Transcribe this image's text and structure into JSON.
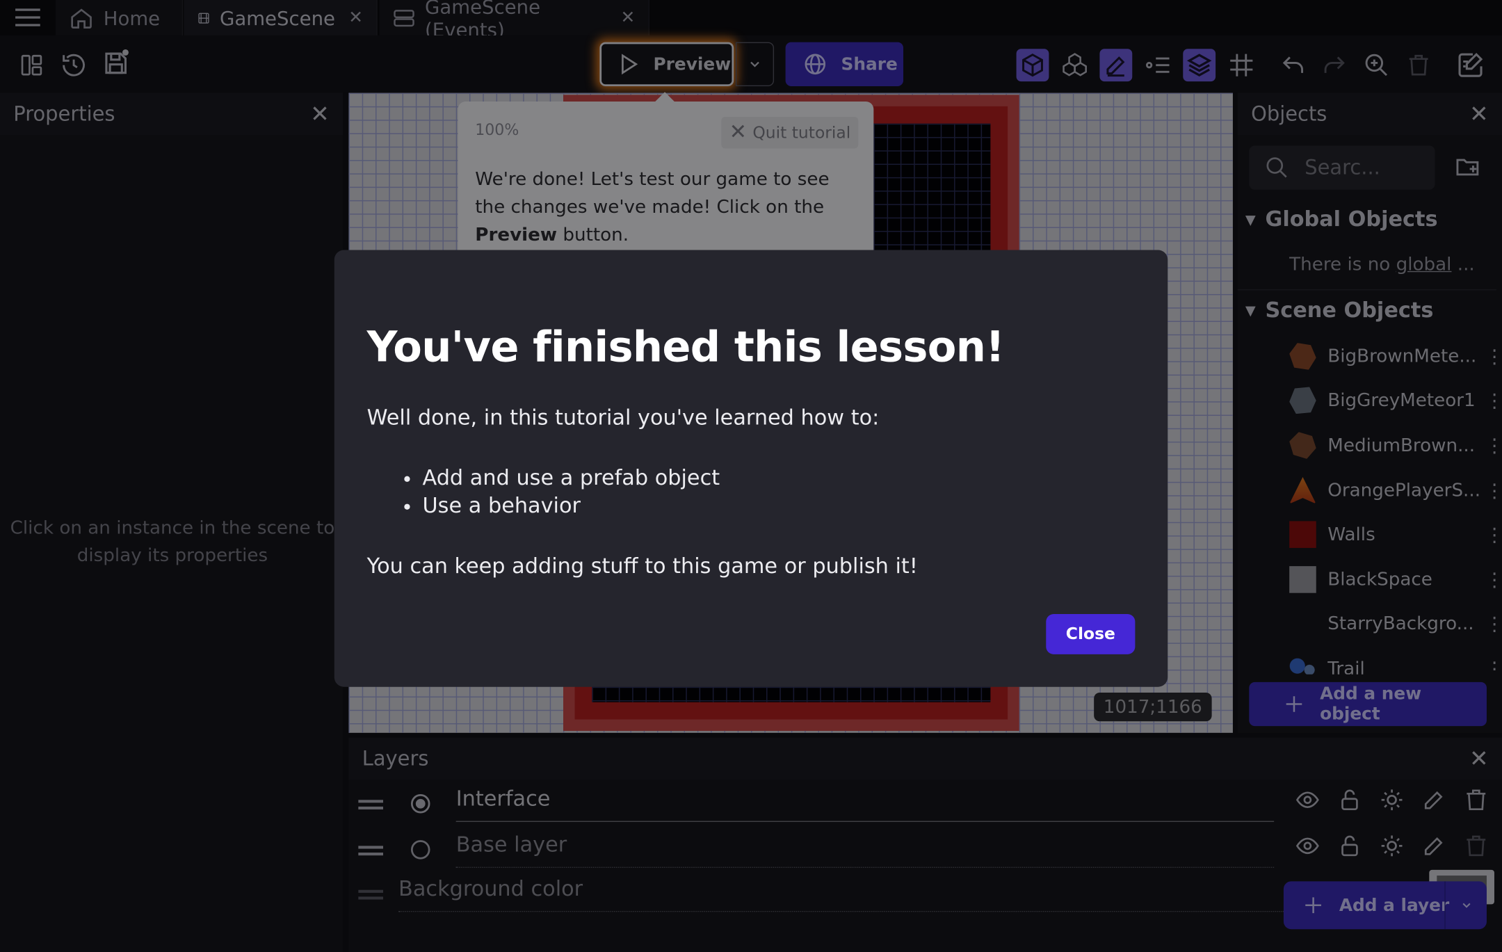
{
  "tabs": [
    {
      "label": "Home",
      "icon": "home-icon"
    },
    {
      "label": "GameScene",
      "icon": "film-icon"
    },
    {
      "label": "GameScene (Events)",
      "icon": "events-icon"
    }
  ],
  "toolbar": {
    "preview_label": "Preview",
    "share_label": "Share",
    "accent_color": "#3b2db8",
    "highlight_color": "#e07a1f"
  },
  "properties": {
    "title": "Properties",
    "empty_message": "Click on an instance in the scene to display its properties"
  },
  "canvas": {
    "coordinates": "1017;1166"
  },
  "tutorial": {
    "zoom": "100%",
    "quit_label": "Quit tutorial",
    "message_prefix": "We're done! Let's test our game to see the changes we've made! Click on the ",
    "message_bold": "Preview",
    "message_suffix": " button."
  },
  "dialog": {
    "title": "You've finished this lesson!",
    "lead": "Well done, in this tutorial you've learned how to:",
    "items": [
      "Add and use a prefab object",
      "Use a behavior"
    ],
    "footer": "You can keep adding stuff to this game or publish it!",
    "close_label": "Close"
  },
  "objects": {
    "title": "Objects",
    "search_placeholder": "Searc...",
    "global_group": "Global Objects",
    "global_empty_prefix": "There is no ",
    "global_empty_link": "global",
    "global_empty_suffix": " ...",
    "scene_group": "Scene Objects",
    "items": [
      {
        "label": "BigBrownMete...",
        "color": "#8a4a2a"
      },
      {
        "label": "BigGreyMeteor1",
        "color": "#6a7480"
      },
      {
        "label": "MediumBrown...",
        "color": "#7a4a30"
      },
      {
        "label": "OrangePlayerS...",
        "color": "#e07a1f"
      },
      {
        "label": "Walls",
        "color": "#8a1010"
      },
      {
        "label": "BlackSpace",
        "color": "#9a9aa0"
      },
      {
        "label": "StarryBackgro...",
        "color": ""
      },
      {
        "label": "Trail",
        "color": "#3a6ad0"
      }
    ],
    "add_label": "Add a new object"
  },
  "layers": {
    "title": "Layers",
    "items": [
      {
        "name": "Interface",
        "selected": true
      },
      {
        "name": "Base layer",
        "selected": false
      }
    ],
    "background_label": "Background color",
    "add_label": "Add a layer"
  }
}
